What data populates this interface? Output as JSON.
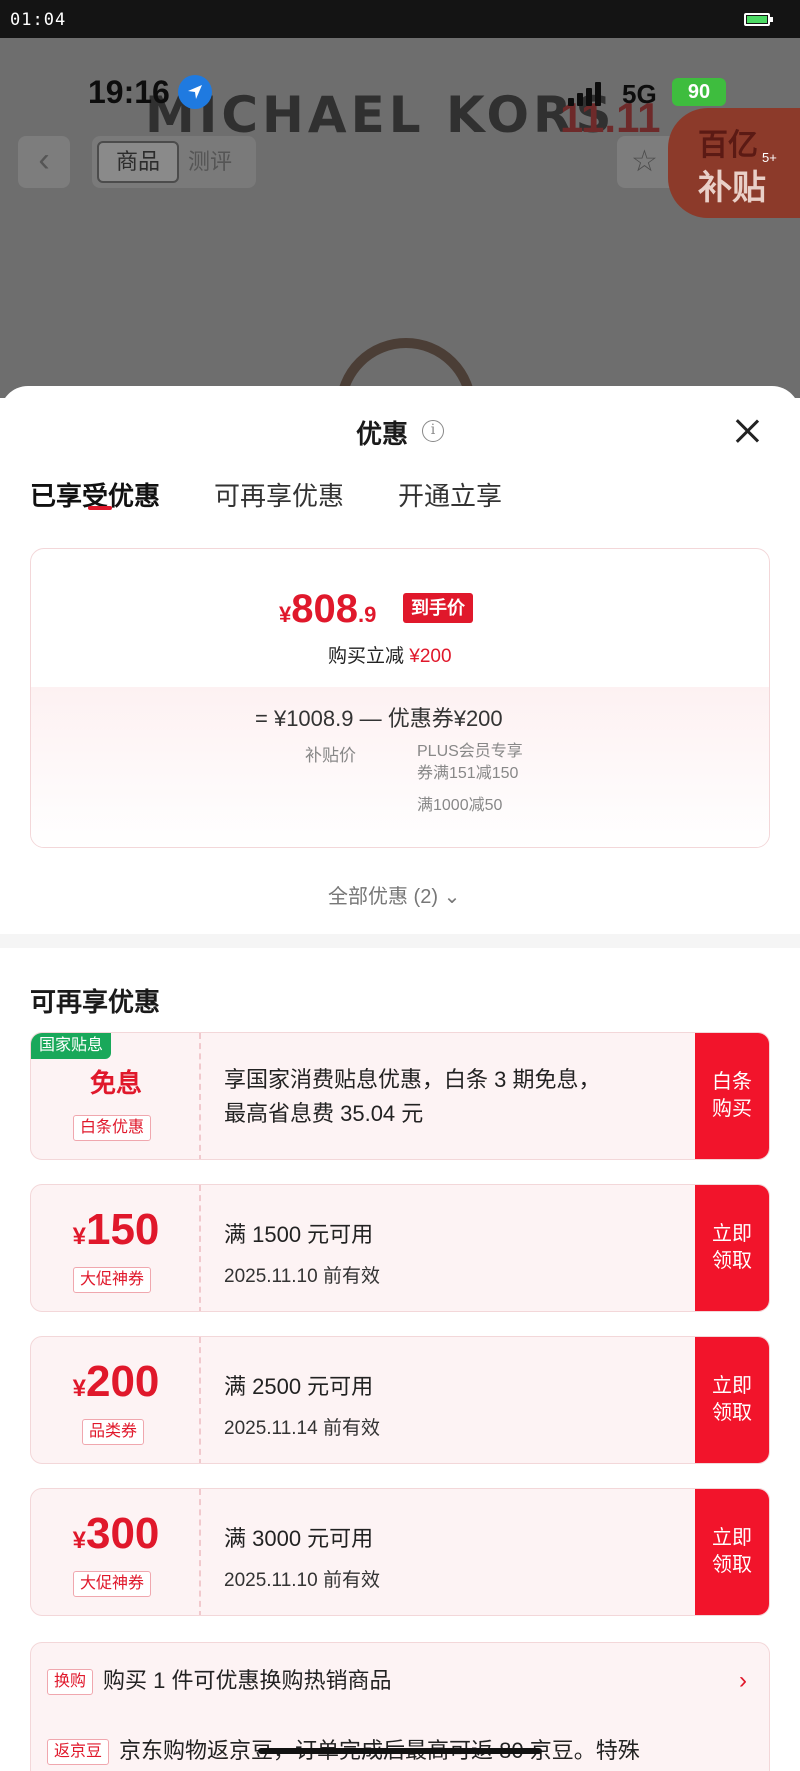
{
  "outer_status": {
    "time": "01:04"
  },
  "background": {
    "brand": "MICHAEL KORS",
    "brand_suffix": "11.11",
    "phone_time": "19:16",
    "network": "5G",
    "battery": "90",
    "segment": {
      "active": "商品",
      "other": "测评"
    },
    "promo_top": "百亿",
    "promo_bottom": "补贴",
    "promo_count": "5+"
  },
  "sheet": {
    "title": "优惠",
    "tabs": [
      "已享受优惠",
      "可再享优惠",
      "开通立享"
    ],
    "price_card": {
      "currency": "¥",
      "final_int": "808",
      "final_dec": ".9",
      "final_badge": "到手价",
      "reduce_text": "购买立减",
      "reduce_amount": "¥200",
      "formula": "=  ¥1008.9  —  优惠券¥200",
      "subsidy_label": "补贴价",
      "coupon_desc_line1": "PLUS会员专享",
      "coupon_desc_line2": "券满151减150",
      "coupon_desc_line3": "满1000减50"
    },
    "all_offers": "全部优惠 (2)",
    "section_title": "可再享优惠",
    "interest_offer": {
      "green_label": "国家贴息",
      "title": "免息",
      "tag": "白条优惠",
      "line1": "享国家消费贴息优惠，白条 3 期免息，",
      "line2": "最高省息费 35.04 元",
      "action_line1": "白条",
      "action_line2": "购买"
    },
    "coupons": [
      {
        "currency": "¥",
        "amount": "150",
        "tag": "大促神券",
        "condition": "满 1500 元可用",
        "valid": "2025.11.10 前有效",
        "action_line1": "立即",
        "action_line2": "领取"
      },
      {
        "currency": "¥",
        "amount": "200",
        "tag": "品类券",
        "condition": "满 2500 元可用",
        "valid": "2025.11.14 前有效",
        "action_line1": "立即",
        "action_line2": "领取"
      },
      {
        "currency": "¥",
        "amount": "300",
        "tag": "大促神券",
        "condition": "满 3000 元可用",
        "valid": "2025.11.10 前有效",
        "action_line1": "立即",
        "action_line2": "领取"
      }
    ],
    "extra": {
      "row1_tag": "换购",
      "row1_text": "购买 1 件可优惠换购热销商品",
      "row1_arrow": "›",
      "row2_tag": "返京豆",
      "row2_text": "京东购物返京豆，订单完成后最高可返 80 京豆。特殊"
    }
  },
  "colors": {
    "accent": "#e0182b",
    "action": "#f2142b",
    "green_label": "#19a85a"
  }
}
